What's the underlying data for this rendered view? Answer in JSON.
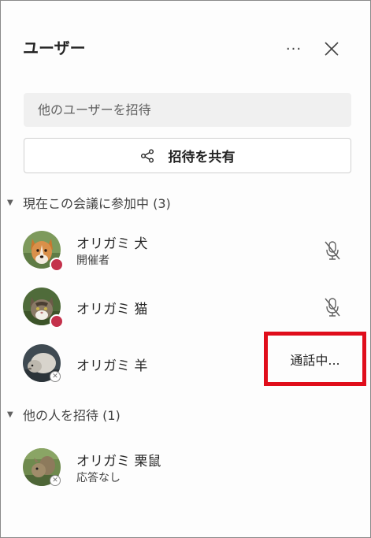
{
  "panel": {
    "title": "ユーザー",
    "more_label": "···",
    "search_placeholder": "他のユーザーを招待",
    "share_label": "招待を共有"
  },
  "sections": [
    {
      "label": "現在この会議に参加中 (3)"
    },
    {
      "label": "他の人を招待 (1)"
    }
  ],
  "participants": [
    {
      "name": "オリガミ 犬",
      "role": "開催者",
      "status": "busy",
      "mic": "muted"
    },
    {
      "name": "オリガミ 猫",
      "role": "",
      "status": "busy",
      "mic": "muted"
    },
    {
      "name": "オリガミ 羊",
      "role": "",
      "status": "offline",
      "action": "通話中..."
    }
  ],
  "invited": [
    {
      "name": "オリガミ 栗鼠",
      "role": "応答なし",
      "status": "offline"
    }
  ],
  "colors": {
    "busy": "#c4314b",
    "highlight": "#e00d1b"
  },
  "icons": [
    "more-icon",
    "close-icon",
    "share-icon",
    "mic-off-icon",
    "caret-down-icon"
  ]
}
